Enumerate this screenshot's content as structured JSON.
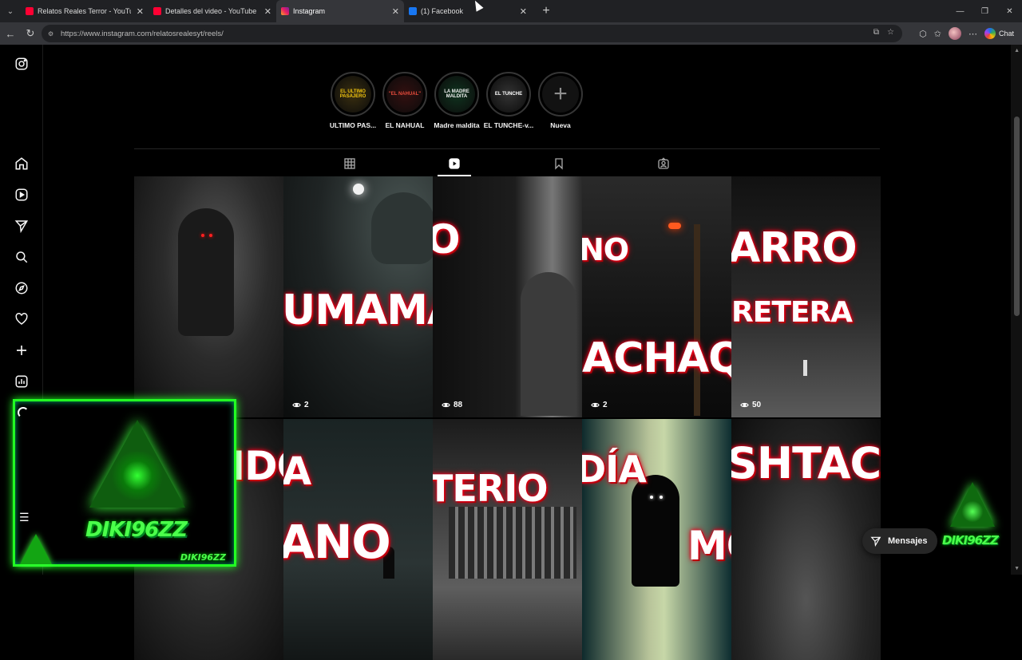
{
  "browser": {
    "tabs": [
      {
        "title": "Relatos Reales Terror - YouTube",
        "favicon": "youtube-icon",
        "active": false
      },
      {
        "title": "Detalles del video - YouTube Studio",
        "favicon": "youtube-icon",
        "active": false
      },
      {
        "title": "Instagram",
        "favicon": "instagram-icon",
        "active": true
      },
      {
        "title": "(1) Facebook",
        "favicon": "facebook-icon",
        "active": false
      }
    ],
    "url": "https://www.instagram.com/relatosrealesyt/reels/",
    "chat_label": "Chat"
  },
  "instagram": {
    "highlights": [
      {
        "label": "ULTIMO PAS...",
        "thumb_text": "EL ULTIMO PASAJERO"
      },
      {
        "label": "EL NAHUAL",
        "thumb_text": "\"EL NAHUAL\""
      },
      {
        "label": "Madre maldita",
        "thumb_text": "LA MADRE MALDITA"
      },
      {
        "label": "EL TUNCHE-v...",
        "thumb_text": "EL TUNCHE"
      },
      {
        "label": "Nueva",
        "thumb_text": "+"
      }
    ],
    "profile_tabs": [
      "posts-grid-icon",
      "reels-icon",
      "saved-icon",
      "tagged-icon"
    ],
    "active_tab": "reels-icon",
    "reels_row1": [
      {
        "overlay": "",
        "views": ""
      },
      {
        "overlay": "UMAMATÉ !",
        "views": "2"
      },
      {
        "overlay": "O",
        "views": "88"
      },
      {
        "overlay": "NO",
        "overlay2": "ACHAQU",
        "views": "2"
      },
      {
        "overlay": "ARRO",
        "overlay2": "RETERA",
        "views": "50"
      }
    ],
    "reels_row2": [
      {
        "overlay": "DIDO",
        "overlay2": "A"
      },
      {
        "overlay": "A",
        "overlay2": "ANO"
      },
      {
        "overlay": "TERIO"
      },
      {
        "overlay": "DÍA",
        "overlay2": "MO"
      },
      {
        "overlay": "SHTACO"
      }
    ],
    "messages_label": "Mensajes"
  },
  "overlay": {
    "streamer_name": "DIKI96ZZ",
    "streamer_tag": "DIKI96ZZ",
    "corner_logo": "DIKI96ZZ"
  },
  "colors": {
    "accent_green": "#22ff22",
    "overlay_red": "#ff0022",
    "chrome_bg": "#202124"
  }
}
